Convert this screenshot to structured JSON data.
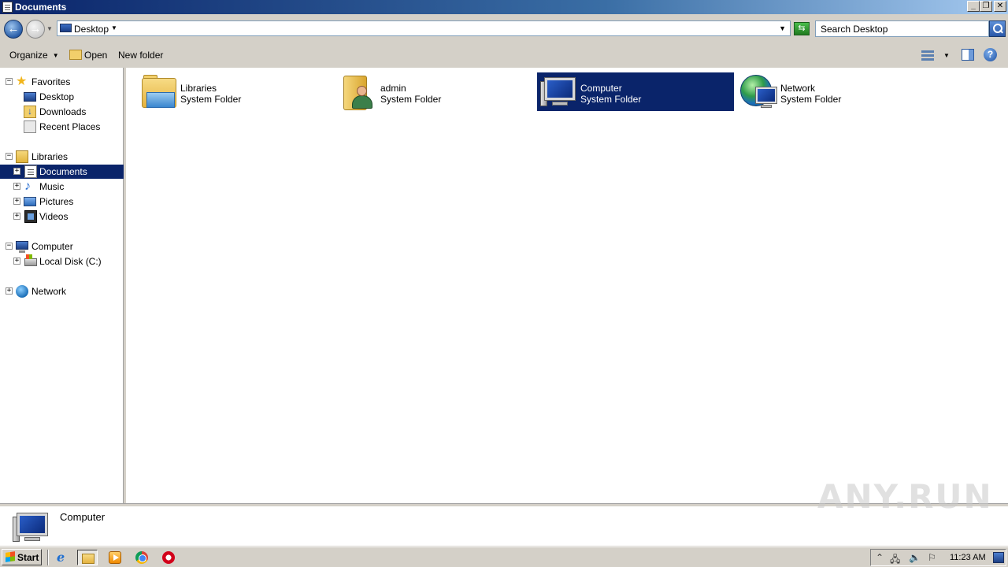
{
  "window": {
    "title": "Documents",
    "controls": {
      "minimize": "_",
      "restore": "❐",
      "close": "✕"
    }
  },
  "address": {
    "location": "Desktop",
    "search_placeholder": "Search Desktop"
  },
  "toolbar": {
    "organize": "Organize",
    "open": "Open",
    "new_folder": "New folder"
  },
  "nav": {
    "favorites": {
      "label": "Favorites",
      "items": [
        {
          "label": "Desktop",
          "icon": "desktop-icon"
        },
        {
          "label": "Downloads",
          "icon": "downloads-icon"
        },
        {
          "label": "Recent Places",
          "icon": "recent-places-icon"
        }
      ]
    },
    "libraries": {
      "label": "Libraries",
      "items": [
        {
          "label": "Documents",
          "icon": "documents-icon",
          "selected": true
        },
        {
          "label": "Music",
          "icon": "music-icon"
        },
        {
          "label": "Pictures",
          "icon": "pictures-icon"
        },
        {
          "label": "Videos",
          "icon": "videos-icon"
        }
      ]
    },
    "computer": {
      "label": "Computer",
      "items": [
        {
          "label": "Local Disk (C:)",
          "icon": "local-disk-icon"
        }
      ]
    },
    "network": {
      "label": "Network"
    }
  },
  "items": [
    {
      "name": "Libraries",
      "type": "System Folder",
      "icon": "libraries-folder-icon"
    },
    {
      "name": "admin",
      "type": "System Folder",
      "icon": "user-folder-icon"
    },
    {
      "name": "Computer",
      "type": "System Folder",
      "icon": "computer-icon",
      "selected": true
    },
    {
      "name": "Network",
      "type": "System Folder",
      "icon": "network-icon"
    }
  ],
  "details": {
    "name": "Computer"
  },
  "watermark": "ANY.RUN",
  "taskbar": {
    "start": "Start",
    "clock": "11:23 AM"
  },
  "colors": {
    "selection": "#0a246a",
    "chrome": "#d4d0c8"
  }
}
